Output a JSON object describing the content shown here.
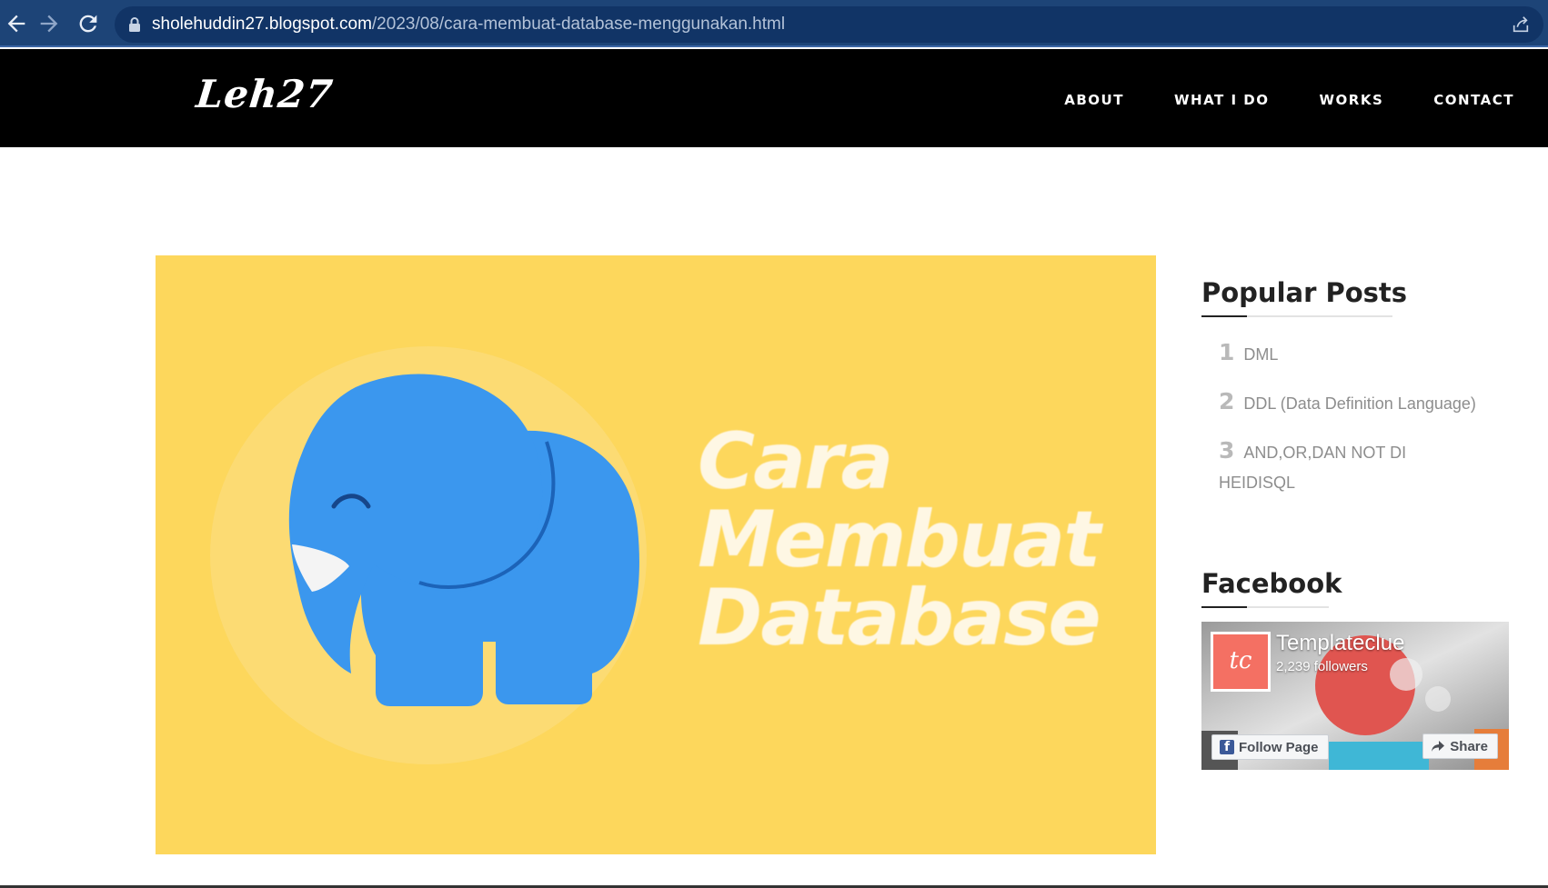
{
  "browser": {
    "url_host": "sholehuddin27.blogspot.com",
    "url_path": "/2023/08/cara-membuat-database-menggunakan.html",
    "icons": [
      "back-arrow-icon",
      "forward-arrow-icon",
      "reload-icon",
      "lock-icon",
      "share-icon"
    ]
  },
  "site": {
    "logo": "Leh27",
    "nav": [
      "ABOUT",
      "WHAT I DO",
      "WORKS",
      "CONTACT"
    ]
  },
  "hero": {
    "title_lines": [
      "Cara",
      "Membuat",
      "Database"
    ],
    "background": "#fdd75c",
    "elephant_color": "#3b97ee"
  },
  "sidebar": {
    "popular": {
      "title": "Popular Posts",
      "items": [
        {
          "num": "1",
          "label": "DML"
        },
        {
          "num": "2",
          "label": "DDL (Data Definition Language)"
        },
        {
          "num": "3",
          "label": "AND,OR,DAN NOT DI HEIDISQL"
        }
      ]
    },
    "facebook": {
      "title": "Facebook",
      "page_name": "Templateclue",
      "followers": "2,239 followers",
      "avatar_text": "tc",
      "follow_label": "Follow Page",
      "share_label": "Share"
    }
  }
}
